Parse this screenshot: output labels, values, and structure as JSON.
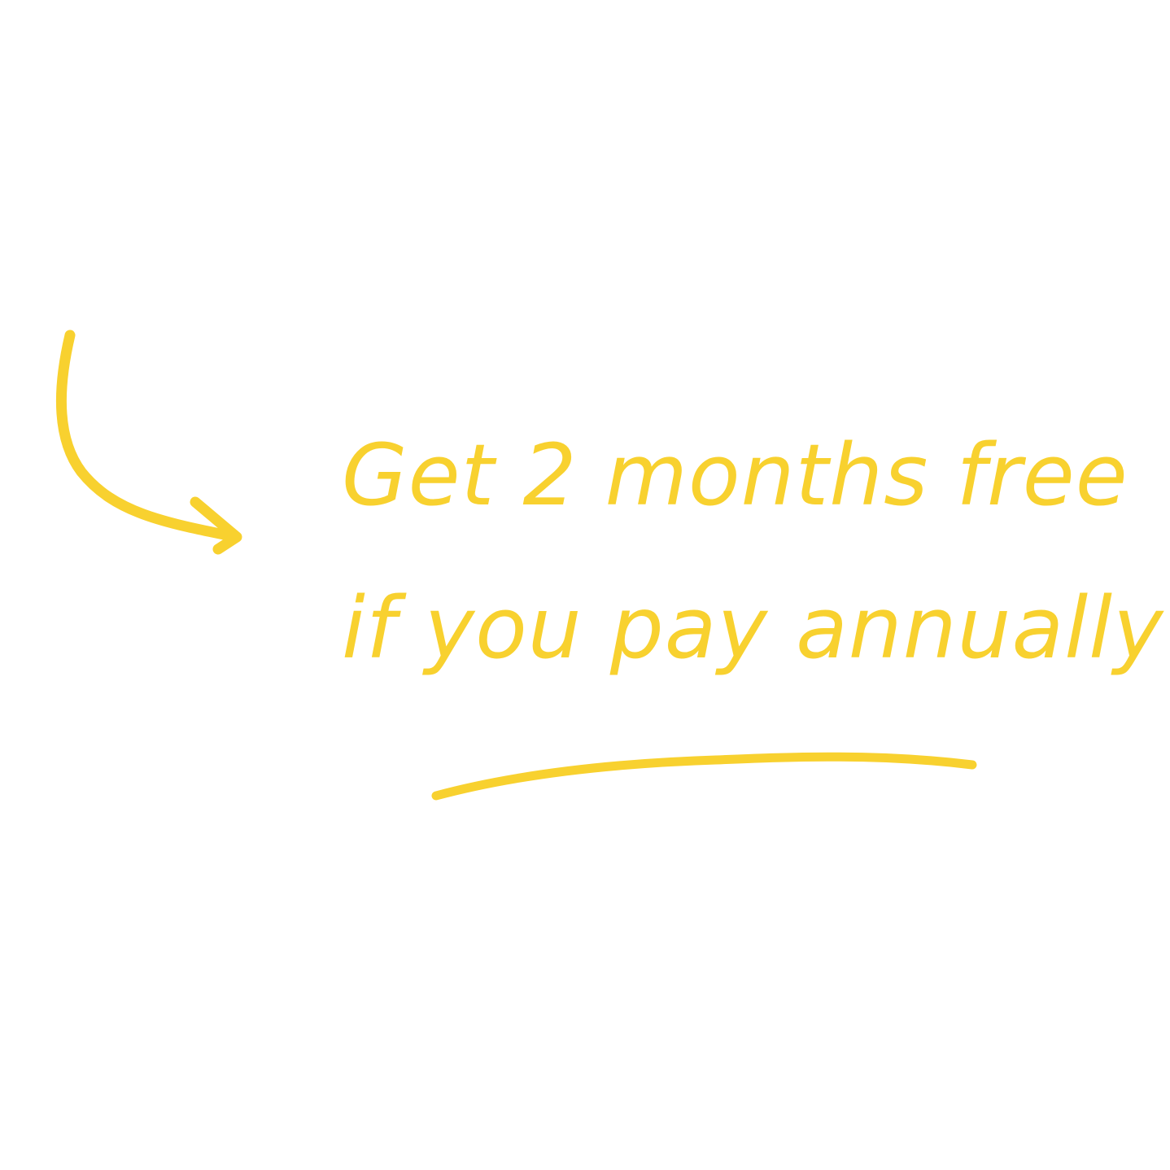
{
  "promo": {
    "line1": "Get 2 months free",
    "line2": "if you pay annually"
  },
  "colors": {
    "accent": "#F8D12F",
    "background": "#FFFFFF"
  },
  "icons": {
    "arrow": "curved-arrow-icon",
    "underline": "hand-drawn-underline"
  }
}
